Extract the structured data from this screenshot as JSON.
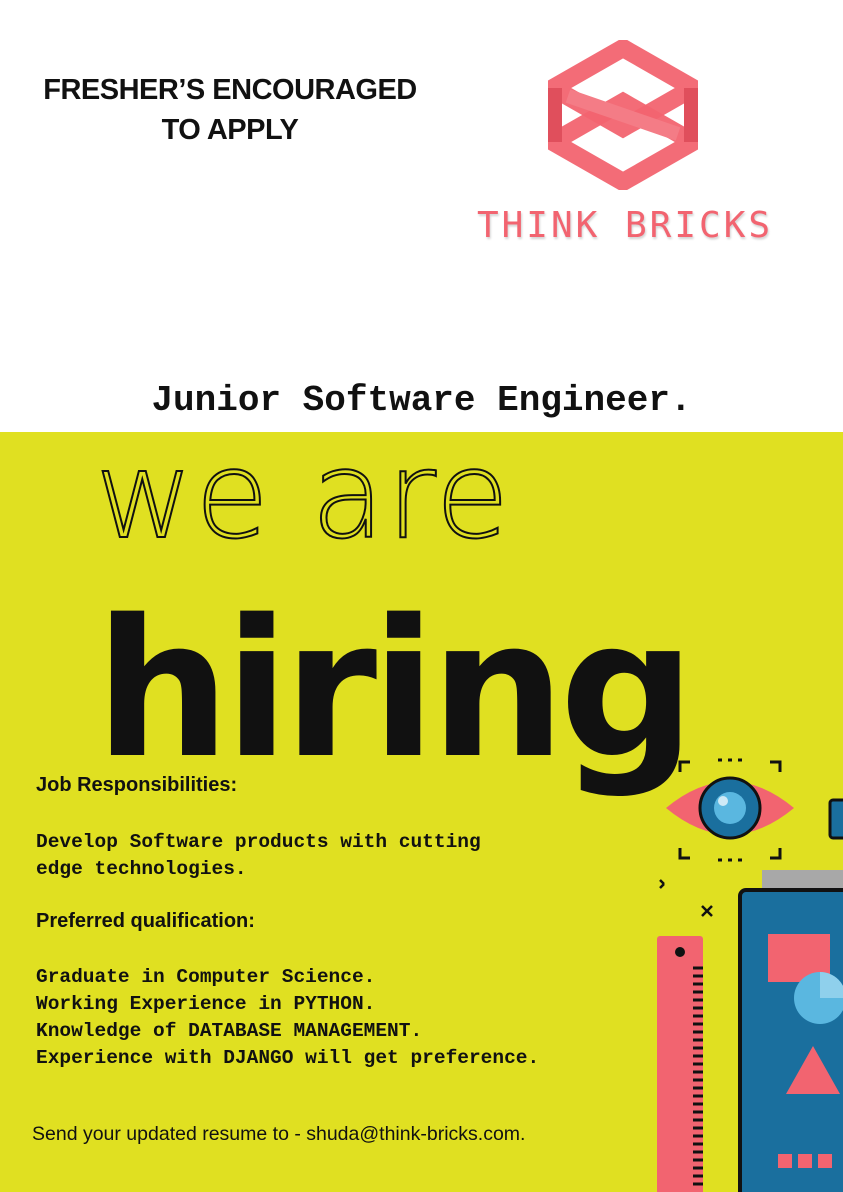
{
  "header": {
    "fresher_line1": "FRESHER’S ENCOURAGED",
    "fresher_line2": "TO APPLY",
    "brand_name": "THINK BRICKS"
  },
  "job_title": "Junior Software Engineer.",
  "headline": {
    "line1": "we are",
    "line2": "hiring"
  },
  "responsibilities": {
    "heading": "Job Responsibilities:",
    "lines": [
      "Develop Software products with cutting",
      "edge technologies."
    ]
  },
  "qualifications": {
    "heading": "Preferred qualification:",
    "lines": [
      "Graduate in Computer Science.",
      "Working Experience in PYTHON.",
      "Knowledge of DATABASE MANAGEMENT.",
      "Experience with DJANGO will get preference."
    ]
  },
  "contact": {
    "text": "Send your updated resume to  -  shuda@think-bricks.com."
  },
  "colors": {
    "accent_yellow": "#e0e021",
    "brand_coral": "#f26470",
    "illustration_blue": "#1a6f9e"
  },
  "icons": [
    "think-bricks-logo-icon",
    "eye-icon",
    "ruler-icon",
    "monitor-icon"
  ]
}
